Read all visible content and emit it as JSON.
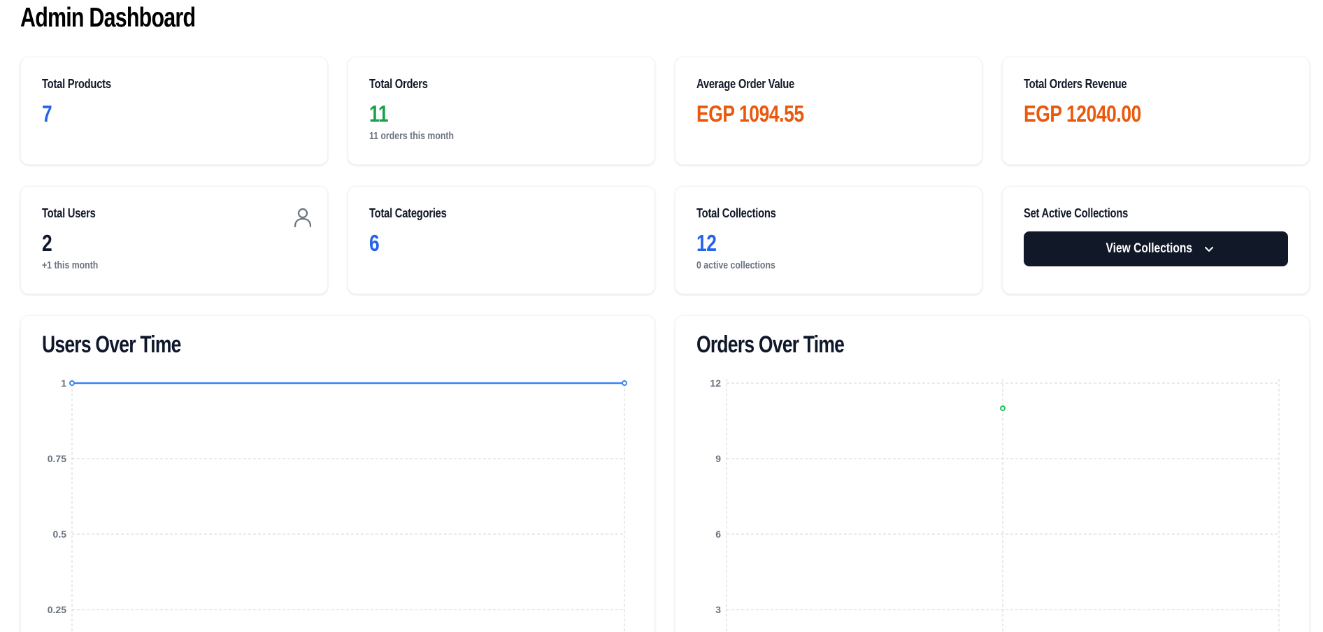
{
  "page": {
    "title": "Admin Dashboard"
  },
  "stats": {
    "total_products": {
      "label": "Total Products",
      "value": "7"
    },
    "total_orders": {
      "label": "Total Orders",
      "value": "11",
      "sub": "11 orders this month"
    },
    "average_order_value": {
      "label": "Average Order Value",
      "value": "EGP 1094.55"
    },
    "total_orders_revenue": {
      "label": "Total Orders Revenue",
      "value": "EGP 12040.00"
    },
    "total_users": {
      "label": "Total Users",
      "value": "2",
      "sub": "+1 this month",
      "icon": "user-icon"
    },
    "total_categories": {
      "label": "Total Categories",
      "value": "6"
    },
    "total_collections": {
      "label": "Total Collections",
      "value": "12",
      "sub": "0 active collections"
    },
    "set_active_collections": {
      "label": "Set Active Collections",
      "button_label": "View Collections",
      "button_icon": "chevron-down-icon"
    }
  },
  "colors": {
    "blue": "#2563eb",
    "green": "#16a34a",
    "orange": "#ea580c",
    "dark": "#111827",
    "muted": "#6b7280"
  },
  "chart_data": [
    {
      "type": "line",
      "title": "Users Over Time",
      "color": "#3b82f6",
      "y_ticks": [
        "1",
        "0.75",
        "0.5",
        "0.25"
      ],
      "ylim": [
        0,
        1
      ],
      "series": [
        {
          "values": [
            1,
            1
          ]
        }
      ],
      "grid": true
    },
    {
      "type": "line",
      "title": "Orders Over Time",
      "color": "#22c55e",
      "y_ticks": [
        "12",
        "9",
        "6",
        "3"
      ],
      "ylim": [
        0,
        12
      ],
      "series": [
        {
          "values": [
            11
          ]
        }
      ],
      "grid": true
    }
  ]
}
